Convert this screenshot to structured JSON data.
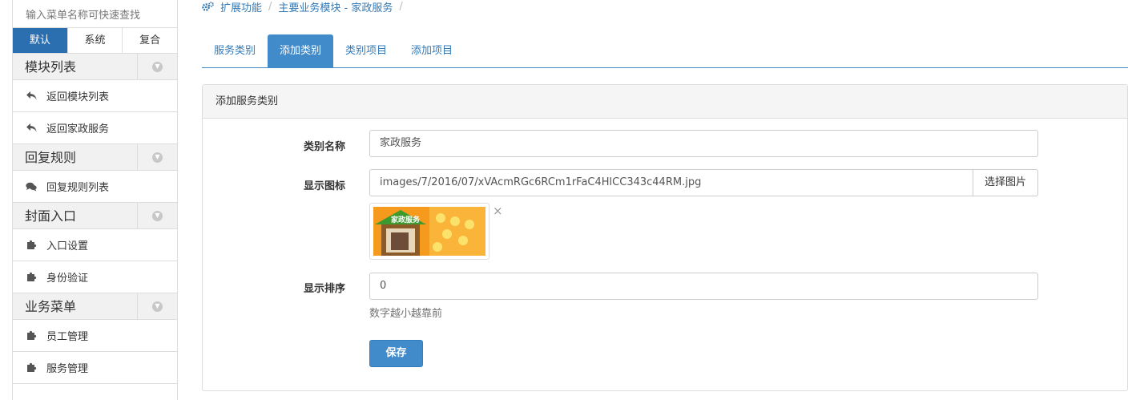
{
  "sidebar": {
    "search_placeholder": "输入菜单名称可快速查找",
    "modes": [
      "默认",
      "系统",
      "复合"
    ],
    "groups": [
      {
        "title": "模块列表",
        "items": [
          {
            "label": "返回模块列表",
            "icon": "reply-icon"
          },
          {
            "label": "返回家政服务",
            "icon": "reply-icon"
          }
        ]
      },
      {
        "title": "回复规则",
        "items": [
          {
            "label": "回复规则列表",
            "icon": "comments-icon"
          }
        ]
      },
      {
        "title": "封面入口",
        "items": [
          {
            "label": "入口设置",
            "icon": "puzzle-icon"
          },
          {
            "label": "身份验证",
            "icon": "puzzle-icon"
          }
        ]
      },
      {
        "title": "业务菜单",
        "items": [
          {
            "label": "员工管理",
            "icon": "puzzle-icon"
          },
          {
            "label": "服务管理",
            "icon": "puzzle-icon"
          }
        ]
      }
    ]
  },
  "breadcrumb": {
    "icon": "cogs-icon",
    "items": [
      "扩展功能",
      "主要业务模块 - 家政服务"
    ]
  },
  "tabs": [
    {
      "label": "服务类别",
      "active": false
    },
    {
      "label": "添加类别",
      "active": true
    },
    {
      "label": "类别项目",
      "active": false
    },
    {
      "label": "添加项目",
      "active": false
    }
  ],
  "panel": {
    "title": "添加服务类别",
    "fields": {
      "name": {
        "label": "类别名称",
        "value": "家政服务"
      },
      "icon": {
        "label": "显示图标",
        "value": "images/7/2016/07/xVAcmRGc6RCm1rFaC4HlCC343c44RM.jpg",
        "button": "选择图片",
        "thumb_text": "家政服务"
      },
      "order": {
        "label": "显示排序",
        "value": "0",
        "help": "数字越小越靠前"
      }
    },
    "save_label": "保存"
  },
  "colors": {
    "primary": "#428bca",
    "active_mode": "#2c6fb1",
    "link": "#337ab7"
  }
}
